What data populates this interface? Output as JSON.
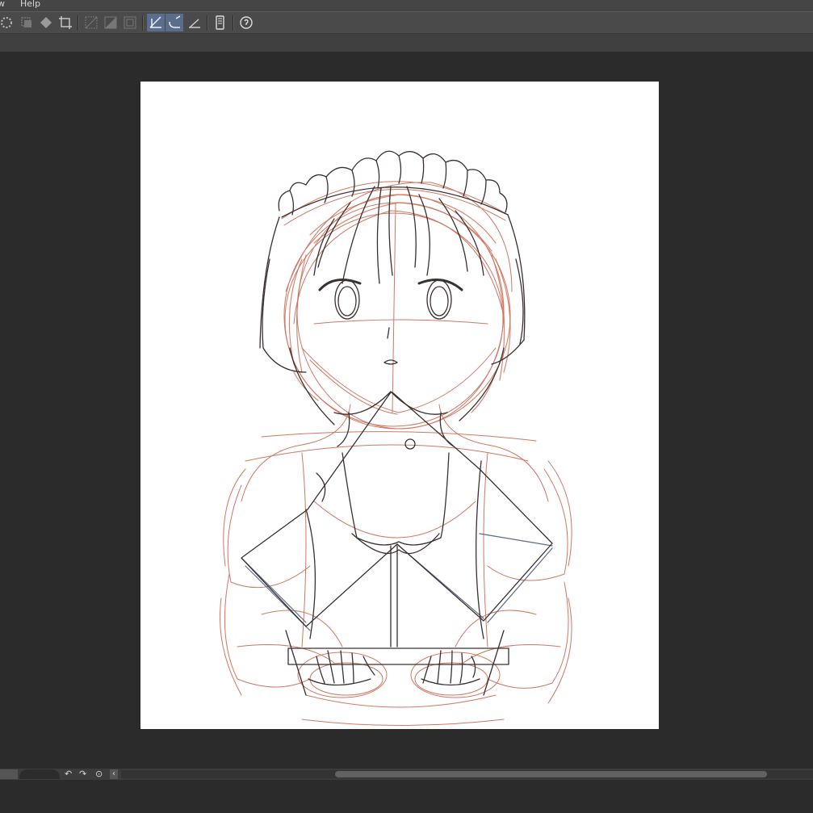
{
  "menu": {
    "items": [
      {
        "label": "w"
      },
      {
        "label": "Help"
      }
    ]
  },
  "toolbar": {
    "buttons": [
      {
        "name": "selection-spin-icon"
      },
      {
        "name": "selection-layer-icon"
      },
      {
        "name": "fill-bucket-icon"
      },
      {
        "name": "transform-crop-icon"
      },
      {
        "name": "ruler-grid-icon"
      },
      {
        "name": "ruler-gradient-icon"
      },
      {
        "name": "ruler-frame-icon"
      },
      {
        "name": "snap-ruler-icon",
        "active": true
      },
      {
        "name": "snap-special-ruler-icon",
        "active": true
      },
      {
        "name": "snap-grid-icon"
      },
      {
        "name": "device-panel-icon"
      },
      {
        "name": "help-icon"
      }
    ]
  },
  "colors": {
    "background": "#2b2b2b",
    "canvas": "#ffffff",
    "sketch_red": "#c8604a",
    "sketch_dark": "#3a3030",
    "sketch_blue": "#5a6b85",
    "active_button": "#5a6d8c"
  },
  "statusbar": {
    "controls": [
      {
        "name": "rotate-left-icon",
        "glyph": "↶"
      },
      {
        "name": "rotate-right-icon",
        "glyph": "↷"
      },
      {
        "name": "reset-rotation-icon",
        "glyph": "⊙"
      },
      {
        "name": "collapse-arrow-icon",
        "glyph": "‹"
      }
    ]
  }
}
